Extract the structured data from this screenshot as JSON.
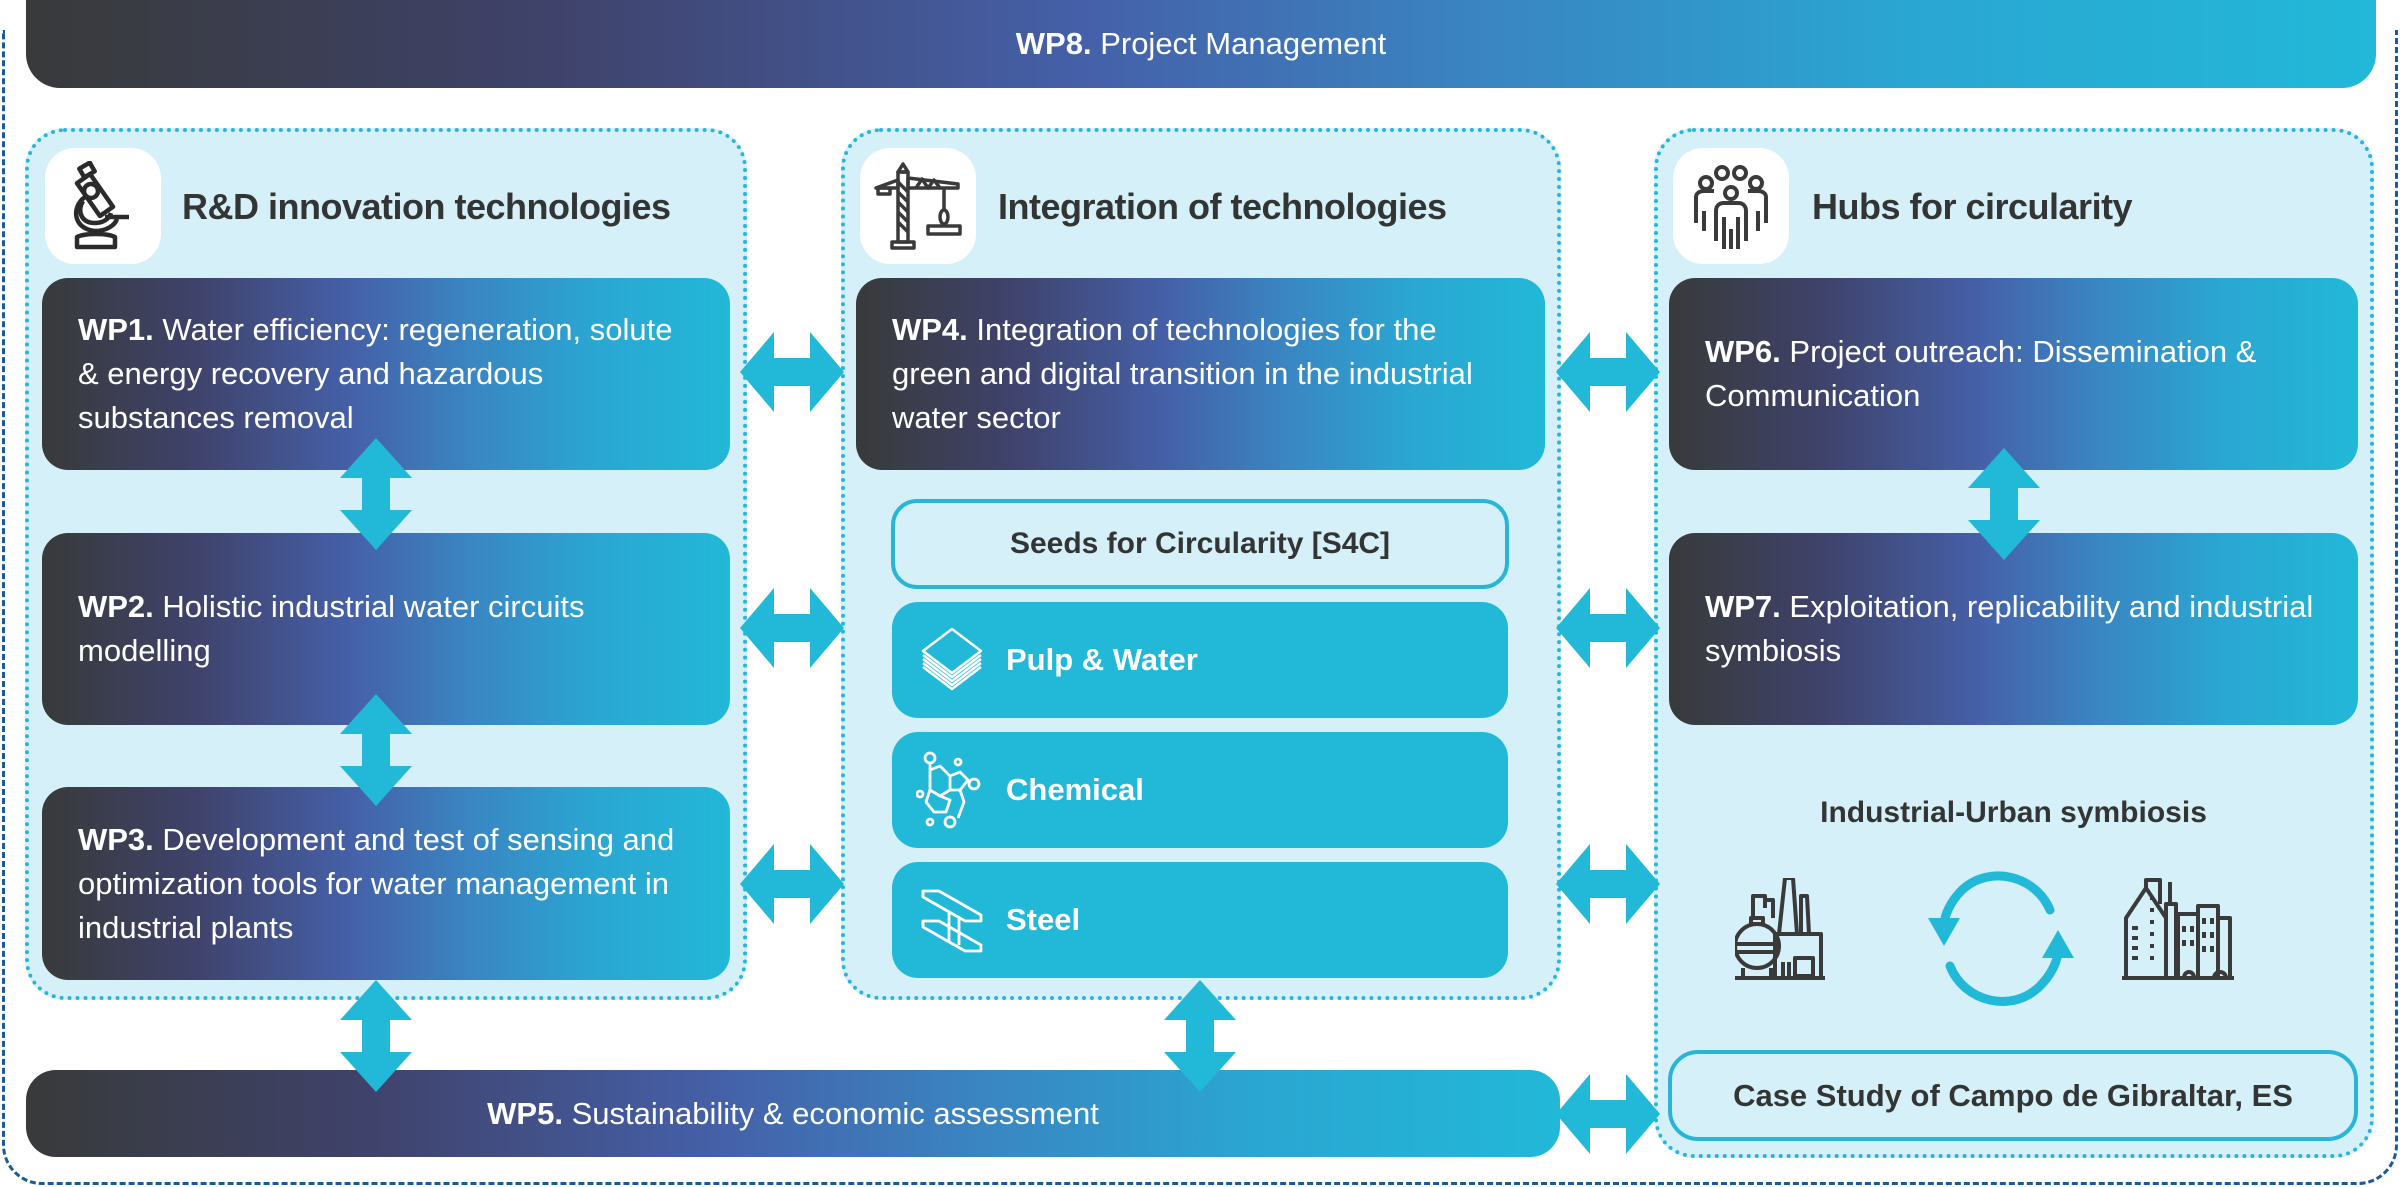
{
  "colors": {
    "accent": "#22b8d8",
    "panel_bg": "#d5f0f8",
    "dark": "#383a3a",
    "mid_blue": "#4560a8",
    "outer_border": "#1b5a9a",
    "text_dark": "#333535"
  },
  "wp8": {
    "code": "WP8.",
    "title": "Project Management"
  },
  "columns": [
    {
      "title": "R&D innovation technologies",
      "icon": "microscope-icon",
      "wps": [
        {
          "code": "WP1.",
          "title": "Water efficiency: regeneration, solute & energy recovery and hazardous substances removal"
        },
        {
          "code": "WP2.",
          "title": "Holistic industrial water circuits modelling"
        },
        {
          "code": "WP3.",
          "title": "Development and test of sensing and optimization tools for water management in industrial plants"
        }
      ]
    },
    {
      "title": "Integration of technologies",
      "icon": "crane-icon",
      "wps": [
        {
          "code": "WP4.",
          "title": "Integration of technologies for the green and digital transition in the industrial water sector"
        }
      ],
      "seeds_label": "Seeds for Circularity [S4C]",
      "sectors": [
        {
          "label": "Pulp & Water",
          "icon": "paper-stack-icon"
        },
        {
          "label": "Chemical",
          "icon": "molecule-icon"
        },
        {
          "label": "Steel",
          "icon": "steel-beam-icon"
        }
      ]
    },
    {
      "title": "Hubs for circularity",
      "icon": "people-group-icon",
      "wps": [
        {
          "code": "WP6.",
          "title": "Project outreach: Dissemination & Communication"
        },
        {
          "code": "WP7.",
          "title": "Exploitation, replicability and industrial symbiosis"
        }
      ],
      "symbiosis_title": "Industrial-Urban symbiosis",
      "symbiosis_icons": [
        "factory-icon",
        "cycle-arrows-icon",
        "city-buildings-icon"
      ],
      "case_study": "Case Study of Campo de Gibraltar, ES"
    }
  ],
  "wp5": {
    "code": "WP5.",
    "title": "Sustainability & economic assessment"
  }
}
